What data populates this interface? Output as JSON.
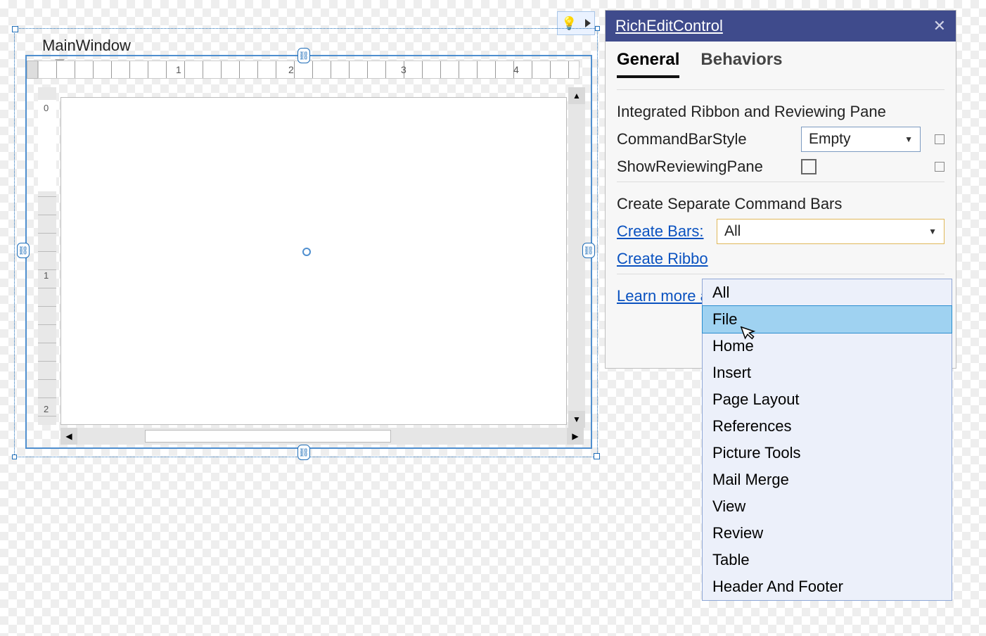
{
  "designer": {
    "window_title": "MainWindow",
    "ruler_numbers": {
      "h1": "1",
      "h2": "2",
      "h3": "3",
      "h4": "4",
      "v0": "0",
      "v1": "1",
      "v2": "2"
    }
  },
  "smart_tag": {
    "icon": "lightbulb"
  },
  "panel": {
    "title": "RichEditControl",
    "tabs": {
      "general": "General",
      "behaviors": "Behaviors"
    },
    "section1": "Integrated Ribbon and Reviewing Pane",
    "command_bar_style_label": "CommandBarStyle",
    "command_bar_style_value": "Empty",
    "show_reviewing_label": "ShowReviewingPane",
    "section2": "Create Separate Command Bars",
    "create_bars_label": "Create Bars:",
    "create_bars_value": "All",
    "create_ribbon_label": "Create Ribbo",
    "learn_more": "Learn more a"
  },
  "dropdown_items": [
    "All",
    "File",
    "Home",
    "Insert",
    "Page Layout",
    "References",
    "Picture Tools",
    "Mail Merge",
    "View",
    "Review",
    "Table",
    "Header And Footer"
  ],
  "dropdown_hover_index": 1
}
